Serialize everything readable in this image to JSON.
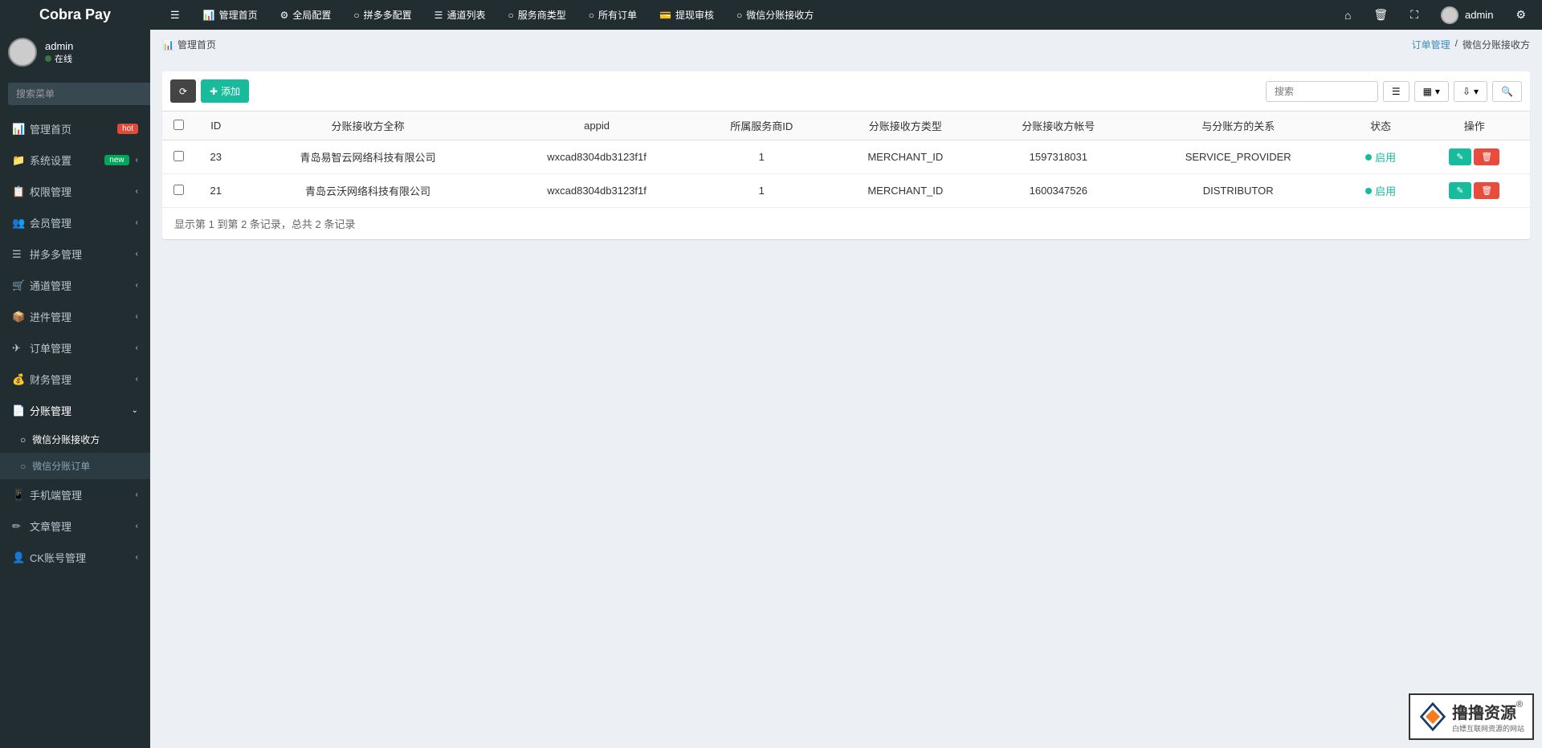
{
  "brand": "Cobra Pay",
  "user": {
    "name": "admin",
    "status": "在线"
  },
  "topnav": [
    {
      "icon": "dashboard",
      "label": "管理首页"
    },
    {
      "icon": "cogs",
      "label": "全局配置"
    },
    {
      "icon": "circle-o",
      "label": "拼多多配置"
    },
    {
      "icon": "list",
      "label": "通道列表"
    },
    {
      "icon": "circle-o",
      "label": "服务商类型"
    },
    {
      "icon": "circle-o",
      "label": "所有订单"
    },
    {
      "icon": "credit-card",
      "label": "提现审核"
    },
    {
      "icon": "circle-o",
      "label": "微信分账接收方"
    }
  ],
  "search_placeholder": "搜索菜单",
  "sidebar": [
    {
      "icon": "dashboard",
      "label": "管理首页",
      "badge": "hot",
      "badgeclass": ""
    },
    {
      "icon": "folder",
      "label": "系统设置",
      "badge": "new",
      "badgeclass": "new",
      "caret": true
    },
    {
      "icon": "group",
      "label": "权限管理",
      "caret": true
    },
    {
      "icon": "users",
      "label": "会员管理",
      "caret": true
    },
    {
      "icon": "list",
      "label": "拼多多管理",
      "caret": true
    },
    {
      "icon": "cart",
      "label": "通道管理",
      "caret": true
    },
    {
      "icon": "archive",
      "label": "进件管理",
      "caret": true
    },
    {
      "icon": "send",
      "label": "订单管理",
      "caret": true
    },
    {
      "icon": "money",
      "label": "财务管理",
      "caret": true
    },
    {
      "icon": "share",
      "label": "分账管理",
      "caret": true,
      "open": true,
      "children": [
        {
          "label": "微信分账接收方",
          "active": true
        },
        {
          "label": "微信分账订单",
          "active": false
        }
      ]
    },
    {
      "icon": "mobile",
      "label": "手机端管理",
      "caret": true
    },
    {
      "icon": "pencil",
      "label": "文章管理",
      "caret": true
    },
    {
      "icon": "user-circle",
      "label": "CK账号管理",
      "caret": true
    }
  ],
  "breadcrumb": {
    "home": "管理首页",
    "parent": "订单管理",
    "current": "微信分账接收方"
  },
  "toolbar": {
    "add": "添加",
    "search_placeholder": "搜索"
  },
  "table": {
    "headers": [
      "ID",
      "分账接收方全称",
      "appid",
      "所属服务商ID",
      "分账接收方类型",
      "分账接收方帐号",
      "与分账方的关系",
      "状态",
      "操作"
    ],
    "rows": [
      {
        "id": "23",
        "name": "青岛易智云网络科技有限公司",
        "appid": "wxcad8304db3123f1f",
        "provider": "1",
        "type": "MERCHANT_ID",
        "account": "1597318031",
        "relation": "SERVICE_PROVIDER",
        "status": "启用"
      },
      {
        "id": "21",
        "name": "青岛云沃网络科技有限公司",
        "appid": "wxcad8304db3123f1f",
        "provider": "1",
        "type": "MERCHANT_ID",
        "account": "1600347526",
        "relation": "DISTRIBUTOR",
        "status": "启用"
      }
    ]
  },
  "pagination": "显示第 1 到第 2 条记录，总共 2 条记录",
  "watermark": {
    "title": "撸撸资源",
    "sub": "白嫖互联网资源的网站"
  }
}
